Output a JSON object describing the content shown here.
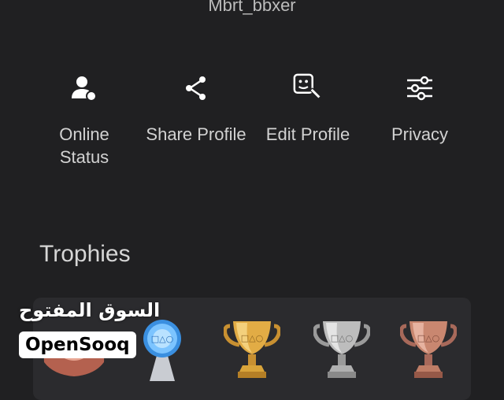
{
  "profile": {
    "username": "Mbrt_bbxer"
  },
  "actions": [
    {
      "label": "Online\nStatus",
      "icon": "online-status-icon"
    },
    {
      "label": "Share Profile",
      "icon": "share-icon"
    },
    {
      "label": "Edit Profile",
      "icon": "edit-profile-icon"
    },
    {
      "label": "Privacy",
      "icon": "sliders-icon"
    }
  ],
  "trophies": {
    "title": "Trophies",
    "types": [
      "level",
      "platinum",
      "gold",
      "silver",
      "bronze"
    ]
  },
  "watermark": {
    "arabic": "السوق المفتوح",
    "english": "OpenSooq"
  },
  "colors": {
    "background": "#202022",
    "card": "#2b2b2e",
    "gold": "#d9a43a",
    "silver": "#bdbdbd",
    "bronze": "#c98770",
    "platinum": "#5aa8e8"
  }
}
